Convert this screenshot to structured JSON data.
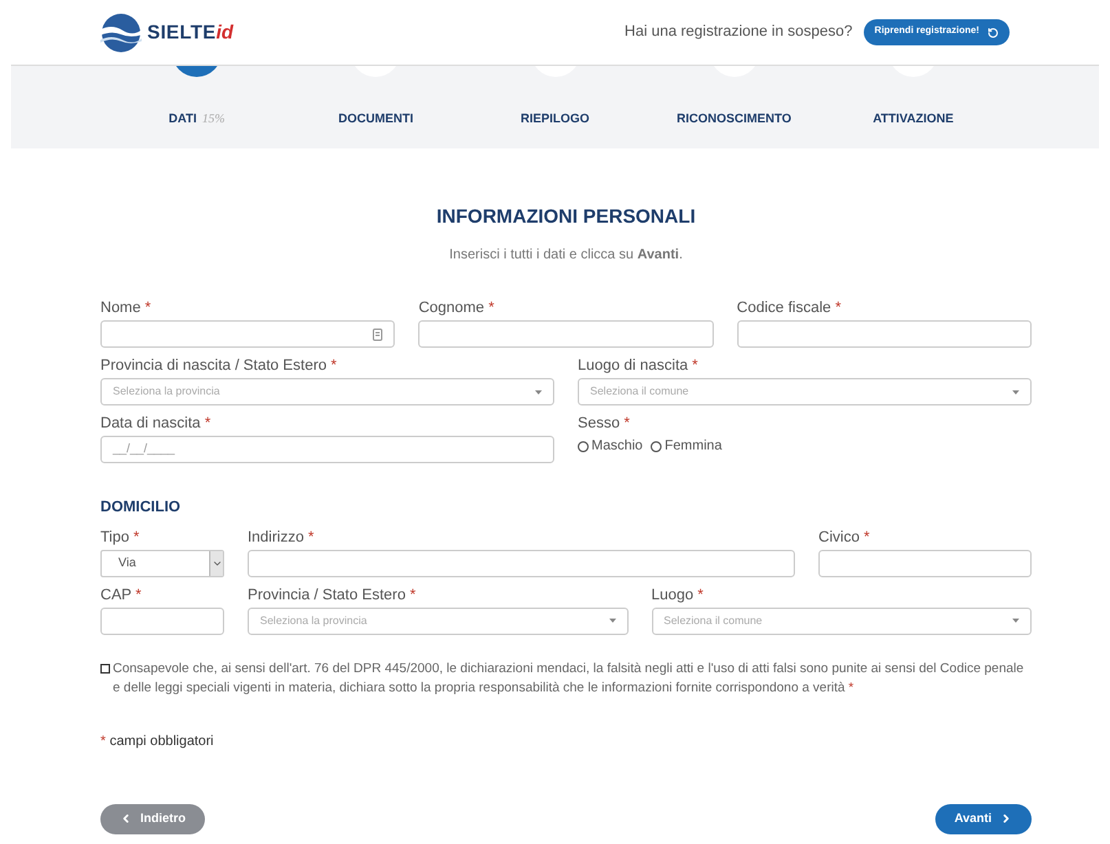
{
  "header": {
    "logo_text": "SIELTE",
    "logo_suffix": "id",
    "pending_question": "Hai una registrazione in sospeso?",
    "resume_button": "Riprendi registrazione!"
  },
  "steps": [
    {
      "label": "DATI",
      "progress": "15%",
      "selected": true
    },
    {
      "label": "DOCUMENTI",
      "selected": false
    },
    {
      "label": "RIEPILOGO",
      "selected": false
    },
    {
      "label": "RICONOSCIMENTO",
      "selected": false
    },
    {
      "label": "ATTIVAZIONE",
      "selected": false
    }
  ],
  "title": "INFORMAZIONI PERSONALI",
  "subtitle": "Inserisci i tutti i dati e clicca su **Avanti**.",
  "personal_rows": [
    [
      {
        "label": "Nome",
        "required": true,
        "kind": "input",
        "icon": true
      },
      {
        "label": "Cognome",
        "required": true,
        "kind": "input"
      },
      {
        "label": "Codice fiscale",
        "required": true,
        "kind": "input"
      }
    ],
    [
      {
        "label": "Provincia di nascita / Stato Estero",
        "required": true,
        "kind": "select",
        "placeholder": "Seleziona la provincia"
      },
      {
        "label": "Luogo di nascita",
        "required": true,
        "kind": "select",
        "placeholder": "Seleziona il comune"
      }
    ],
    [
      {
        "label": "Data di nascita",
        "required": true,
        "kind": "input",
        "placeholder": "__/__/____"
      },
      {
        "label": "Sesso",
        "required": true,
        "kind": "radio",
        "options": [
          {
            "label": "Maschio",
            "selected": false
          },
          {
            "label": "Femmina",
            "selected": false
          }
        ]
      }
    ]
  ],
  "domicile_title": "DOMICILIO",
  "domicile_rows": [
    [
      {
        "label": "Tipo",
        "required": true,
        "kind": "native",
        "value": "Via"
      },
      {
        "label": "Indirizzo",
        "required": true,
        "kind": "input"
      },
      {
        "label": "Civico",
        "required": true,
        "kind": "input"
      }
    ],
    [
      {
        "label": "CAP",
        "required": true,
        "kind": "input"
      },
      {
        "label": "Provincia / Stato Estero",
        "required": true,
        "kind": "select",
        "placeholder": "Seleziona la provincia"
      },
      {
        "label": "Luogo",
        "required": true,
        "kind": "select",
        "placeholder": "Seleziona il comune"
      }
    ]
  ],
  "consent": {
    "checked": false,
    "text": "Consapevole che, ai sensi dell'art. 76 del DPR 445/2000, le dichiarazioni mendaci, la falsità negli atti e l'uso di atti falsi sono punite ai sensi del Codice penale e delle leggi speciali vigenti in materia, dichiara sotto la propria responsabilità che le informazioni fornite corrispondono a verità",
    "required": true
  },
  "required_note": {
    "mark": "*",
    "text": "campi obbligatori"
  },
  "buttons": {
    "back": "Indietro",
    "next": "Avanti"
  }
}
